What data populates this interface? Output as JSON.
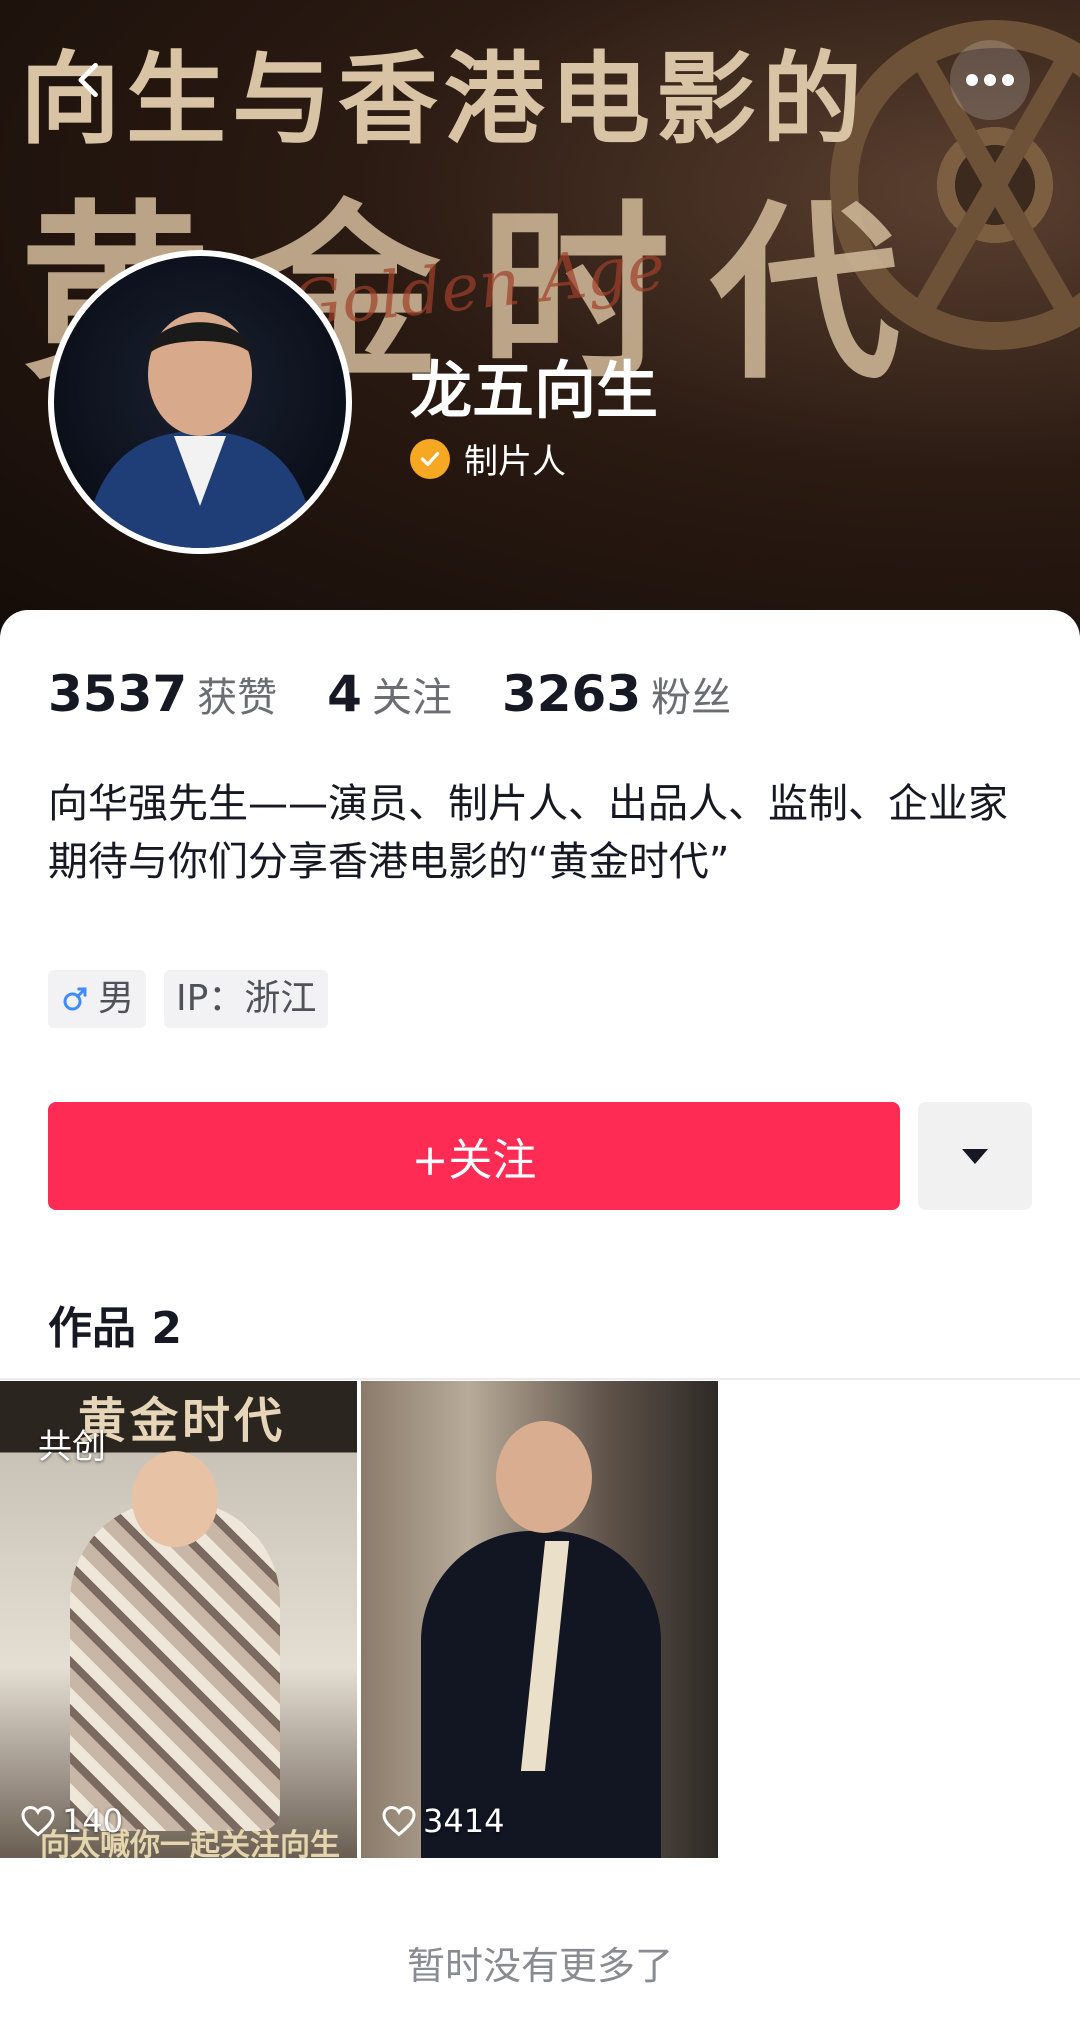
{
  "banner": {
    "title_line1": "向生与香港电影的",
    "title_line2": "黄金时代",
    "script_text": "Golden Age"
  },
  "profile": {
    "name": "龙五向生",
    "verification": "制片人"
  },
  "stats": [
    {
      "value": "3537",
      "label": "获赞"
    },
    {
      "value": "4",
      "label": "关注"
    },
    {
      "value": "3263",
      "label": "粉丝"
    }
  ],
  "bio": {
    "line1": "向华强先生——演员、制片人、出品人、监制、企业家",
    "line2": "期待与你们分享香港电影的“黄金时代”"
  },
  "tags": {
    "gender": "男",
    "ip": "IP：浙江"
  },
  "actions": {
    "follow_label": "+关注"
  },
  "works": {
    "title": "作品 2",
    "items": [
      {
        "badge": "共创",
        "top_text": "黄金时代",
        "bottom_text": "向太喊你一起关注向生",
        "likes": "140"
      },
      {
        "likes": "3414"
      }
    ]
  },
  "footer": {
    "end_note": "暂时没有更多了"
  },
  "colors": {
    "follow_button": "#fe2c55",
    "verify_badge": "#f7a823"
  }
}
